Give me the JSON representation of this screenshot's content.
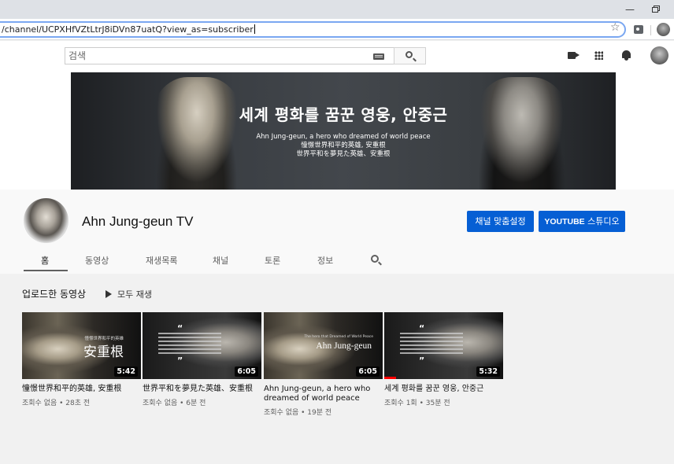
{
  "browser": {
    "url": "/channel/UCPXHfVZtLtrJ8iDVn87uatQ?view_as=subscriber",
    "min_glyph": "—",
    "star_glyph": "☆"
  },
  "masthead": {
    "search_placeholder": "검색"
  },
  "banner": {
    "title": "세계 평화를 꿈꾼 영웅, 안중근",
    "sub_en": "Ahn Jung-geun, a hero who dreamed of world peace",
    "sub_zh": "憧憬世界和平的英雄, 安重根",
    "sub_ja": "世界平和を夢見た英雄、安重根"
  },
  "channel": {
    "name": "Ahn Jung-geun TV",
    "customize_label": "채널 맞춤설정",
    "studio_label_bold": "YOUTUBE",
    "studio_label_rest": " 스튜디오",
    "tabs": [
      "홈",
      "동영상",
      "재생목록",
      "채널",
      "토론",
      "정보"
    ]
  },
  "uploads": {
    "section_title": "업로드한 동영상",
    "play_all": "모두 재생",
    "videos": [
      {
        "title": "憧憬世界和平的英雄, 安重根",
        "meta": "조회수 없음 • 28초 전",
        "duration": "5:42",
        "thumb_big": "安重根",
        "thumb_small": "憧憬世界和平的英雄",
        "progress": 0
      },
      {
        "title": "世界平和を夢見た英雄、安重根",
        "meta": "조회수 없음 • 6분 전",
        "duration": "6:05",
        "thumb_open_quote": "“",
        "thumb_close_quote": "”",
        "progress": 0
      },
      {
        "title": "Ahn Jung-geun, a hero who dreamed of world peace",
        "meta": "조회수 없음 • 19분 전",
        "duration": "6:05",
        "thumb_big": "Ahn Jung-geun",
        "thumb_small": "The hero that Dreamed of World Peace",
        "progress": 0
      },
      {
        "title": "세계 평화를 꿈꾼 영웅, 안중근",
        "meta": "조회수 1회 • 35분 전",
        "duration": "5:32",
        "thumb_open_quote": "“",
        "thumb_close_quote": "”",
        "progress": 0.1
      }
    ]
  }
}
